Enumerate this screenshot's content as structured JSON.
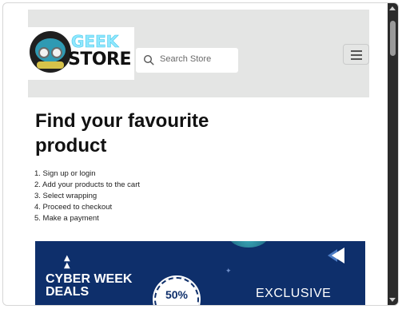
{
  "header": {
    "logo": {
      "top_text": "GEEK",
      "bottom_text": "STORE"
    },
    "search": {
      "placeholder": "Search Store"
    },
    "menu_icon": "hamburger-menu-icon"
  },
  "main": {
    "heading": "Find your favourite product",
    "steps": [
      "1. Sign up or login",
      "2. Add your products to the cart",
      "3. Select wrapping",
      "4. Proceed to checkout",
      "5. Make a payment"
    ]
  },
  "banner": {
    "title_line1": "CYBER WEEK",
    "title_line2": "DEALS",
    "discount": "50%",
    "tagline": "EXCLUSIVE"
  },
  "colors": {
    "header_bg": "#e4e5e4",
    "banner_bg": "#0e2f6b",
    "logo_accent": "#8fe8ff",
    "scrollbar": "#2b2b2b"
  }
}
